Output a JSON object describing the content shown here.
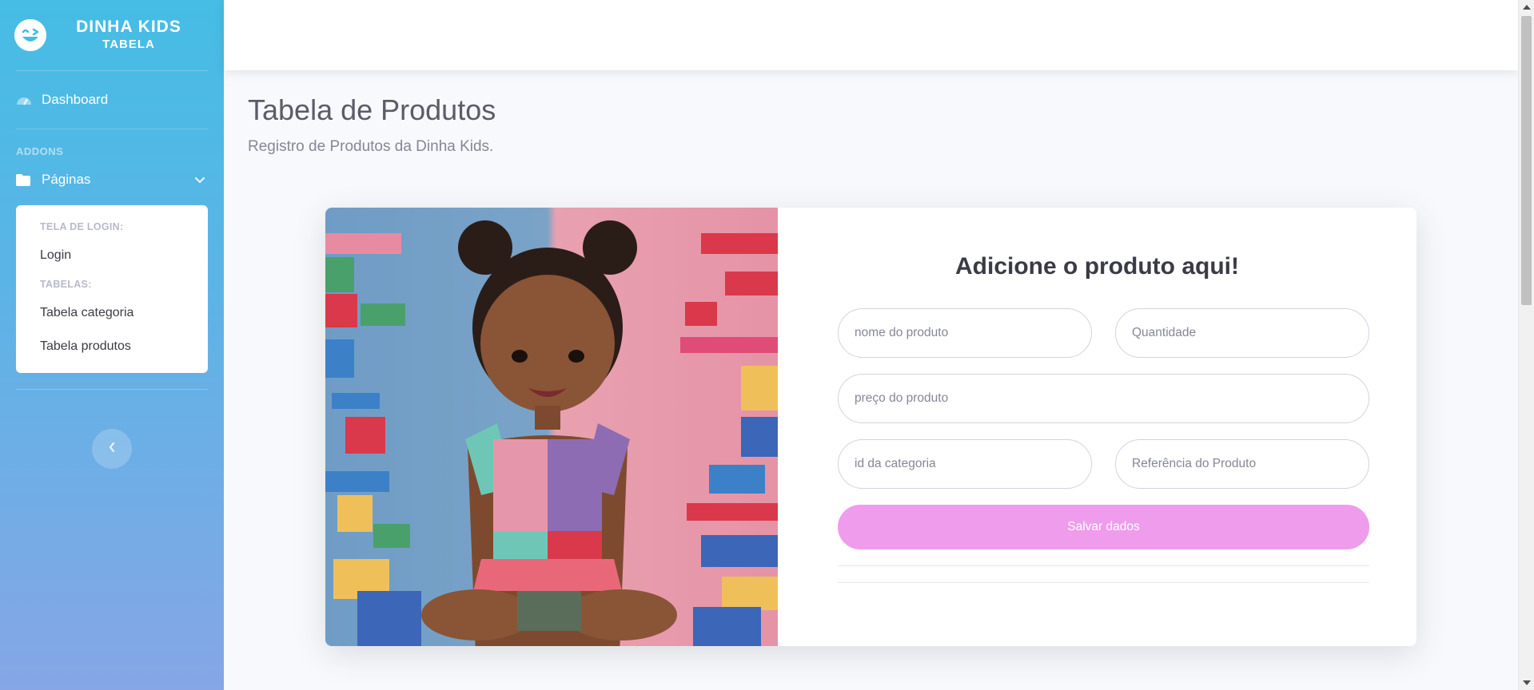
{
  "sidebar": {
    "brand_title": "DINHA KIDS",
    "brand_subtitle": "TABELA",
    "dashboard_label": "Dashboard",
    "addons_heading": "ADDONS",
    "pages_label": "Páginas",
    "submenu": {
      "login_heading": "TELA DE LOGIN:",
      "login_item": "Login",
      "tables_heading": "TABELAS:",
      "category_item": "Tabela categoria",
      "products_item": "Tabela produtos"
    }
  },
  "page": {
    "title": "Tabela de Produtos",
    "subtitle": "Registro de Produtos da Dinha Kids."
  },
  "form": {
    "title": "Adicione o produto aqui!",
    "product_name_placeholder": "nome do produto",
    "quantity_placeholder": "Quantidade",
    "price_placeholder": "preço do produto",
    "category_id_placeholder": "id da categoria",
    "reference_placeholder": "Referência do Produto",
    "save_label": "Salvar dados"
  },
  "colors": {
    "sidebar_top": "#45bde4",
    "sidebar_bottom": "#86a6e6",
    "save_button": "#ef9ced"
  }
}
